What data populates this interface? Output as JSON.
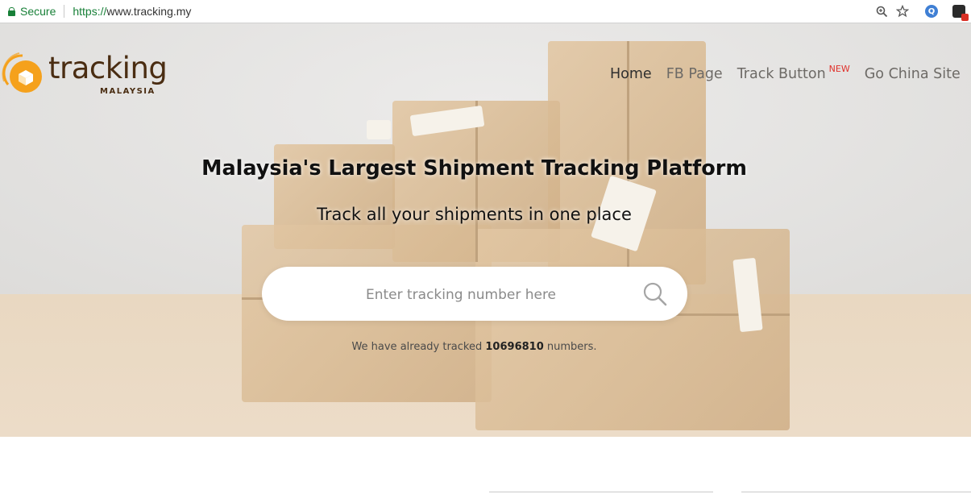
{
  "browser": {
    "secure_label": "Secure",
    "url_scheme": "https://",
    "url_rest": "www.tracking.my",
    "icons": [
      "zoom-icon",
      "bookmark-star-icon",
      "extension-icon",
      "extension-badge-icon"
    ]
  },
  "header": {
    "logo_text": "tracking",
    "logo_sub": "MALAYSIA",
    "nav": [
      {
        "label": "Home",
        "active": true
      },
      {
        "label": "FB Page",
        "active": false
      },
      {
        "label": "Track Button",
        "badge": "NEW",
        "active": false
      },
      {
        "label": "Go China Site",
        "active": false
      }
    ]
  },
  "hero": {
    "title": "Malaysia's Largest Shipment Tracking Platform",
    "subtitle": "Track all your shipments in one place",
    "search_placeholder": "Enter tracking number here",
    "counter_prefix": "We have already tracked",
    "counter_value": "10696810",
    "counter_suffix": "numbers."
  },
  "colors": {
    "brand_orange": "#f5a11c",
    "brand_brown": "#4a2d12",
    "new_badge": "#e0302a",
    "secure_green": "#188038"
  }
}
